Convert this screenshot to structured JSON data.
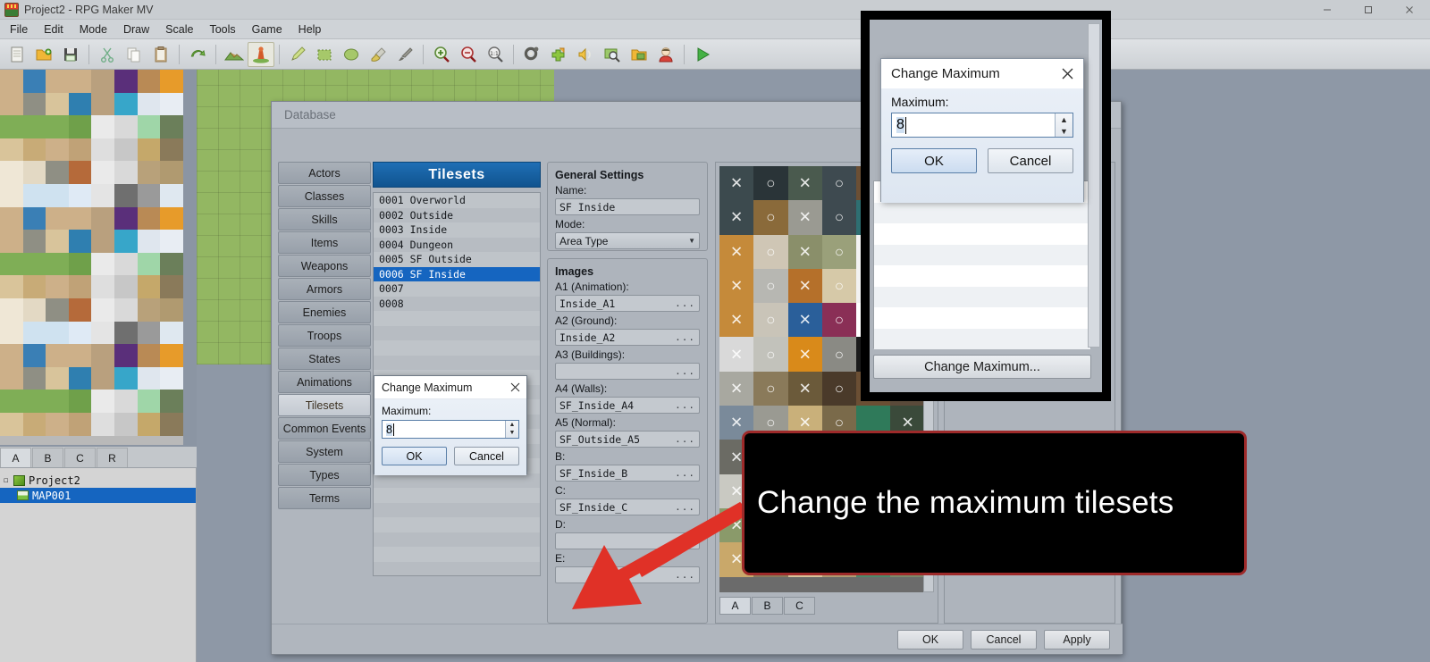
{
  "window": {
    "title": "Project2 - RPG Maker MV",
    "icon": "rpgmaker-logo-icon",
    "controls": [
      {
        "name": "minimize-button",
        "glyph": "minimize-icon"
      },
      {
        "name": "maximize-button",
        "glyph": "maximize-icon"
      },
      {
        "name": "close-button",
        "glyph": "close-icon"
      }
    ]
  },
  "menubar": {
    "items": [
      "File",
      "Edit",
      "Mode",
      "Draw",
      "Scale",
      "Tools",
      "Game",
      "Help"
    ]
  },
  "toolbar": {
    "groups": [
      [
        "new-project-icon",
        "open-project-icon",
        "save-project-icon"
      ],
      [
        "cut-icon",
        "copy-icon",
        "paste-icon"
      ],
      [
        "undo-icon"
      ],
      [
        "map-mode-icon",
        "event-mode-icon"
      ],
      [
        "pencil-tool-icon",
        "rectangle-tool-icon",
        "ellipse-tool-icon",
        "fill-tool-icon",
        "shadow-pen-icon"
      ],
      [
        "zoom-in-icon",
        "zoom-out-icon",
        "zoom-actual-icon"
      ],
      [
        "database-icon",
        "plugin-manager-icon",
        "sound-test-icon",
        "event-search-icon",
        "resource-manager-icon",
        "character-generator-icon"
      ],
      [
        "playtest-icon"
      ]
    ]
  },
  "map_tree": {
    "tabs": [
      "A",
      "B",
      "C",
      "R"
    ],
    "selected_tab": "A",
    "nodes": [
      {
        "label": "Project2",
        "type": "project",
        "selected": false
      },
      {
        "label": "MAP001",
        "type": "map",
        "selected": true
      }
    ]
  },
  "database": {
    "title": "Database",
    "categories": [
      "Actors",
      "Classes",
      "Skills",
      "Items",
      "Weapons",
      "Armors",
      "Enemies",
      "Troops",
      "States",
      "Animations",
      "Tilesets",
      "Common Events",
      "System",
      "Types",
      "Terms"
    ],
    "selected_category": "Tilesets",
    "list": {
      "header": "Tilesets",
      "items": [
        "0001 Overworld",
        "0002 Outside",
        "0003 Inside",
        "0004 Dungeon",
        "0005 SF Outside",
        "0006 SF Inside",
        "0007",
        "0008"
      ],
      "selected_index": 5,
      "change_max_button": "Change Maximum..."
    },
    "general_settings": {
      "title": "General Settings",
      "name_label": "Name:",
      "name_value": "SF Inside",
      "mode_label": "Mode:",
      "mode_value": "Area Type"
    },
    "images": {
      "title": "Images",
      "browse_glyph": "...",
      "fields": [
        {
          "label": "A1 (Animation):",
          "value": "Inside_A1"
        },
        {
          "label": "A2 (Ground):",
          "value": "Inside_A2"
        },
        {
          "label": "A3 (Buildings):",
          "value": ""
        },
        {
          "label": "A4 (Walls):",
          "value": "SF_Inside_A4"
        },
        {
          "label": "A5 (Normal):",
          "value": "SF_Outside_A5"
        },
        {
          "label": "B:",
          "value": "SF_Inside_B"
        },
        {
          "label": "C:",
          "value": "SF_Inside_C"
        },
        {
          "label": "D:",
          "value": ""
        },
        {
          "label": "E:",
          "value": ""
        }
      ]
    },
    "preview": {
      "tabs": [
        "A",
        "B",
        "C"
      ],
      "selected_tab": "A",
      "passage_marks": [
        "X",
        "O"
      ]
    },
    "footer_buttons": [
      "OK",
      "Cancel",
      "Apply"
    ]
  },
  "change_maximum_dialog": {
    "title": "Change Maximum",
    "close_glyph": "close-icon",
    "field_label": "Maximum:",
    "field_value": "8",
    "ok_label": "OK",
    "cancel_label": "Cancel"
  },
  "magnifier": {
    "dialog": {
      "title": "Change Maximum",
      "close_glyph": "close-icon",
      "field_label": "Maximum:",
      "field_value": "8",
      "ok_label": "OK",
      "cancel_label": "Cancel"
    },
    "change_max_button": "Change Maximum..."
  },
  "callout": {
    "text": "Change the maximum tilesets",
    "border_color": "#9e2a2a",
    "background_color": "#000000",
    "text_color": "#ffffff",
    "arrow_color": "#e03127"
  },
  "colors": {
    "accent_blue": "#1565c0",
    "window_chrome": "#b0b6be",
    "list_header": "#10538f",
    "map_green": "#93b762"
  }
}
